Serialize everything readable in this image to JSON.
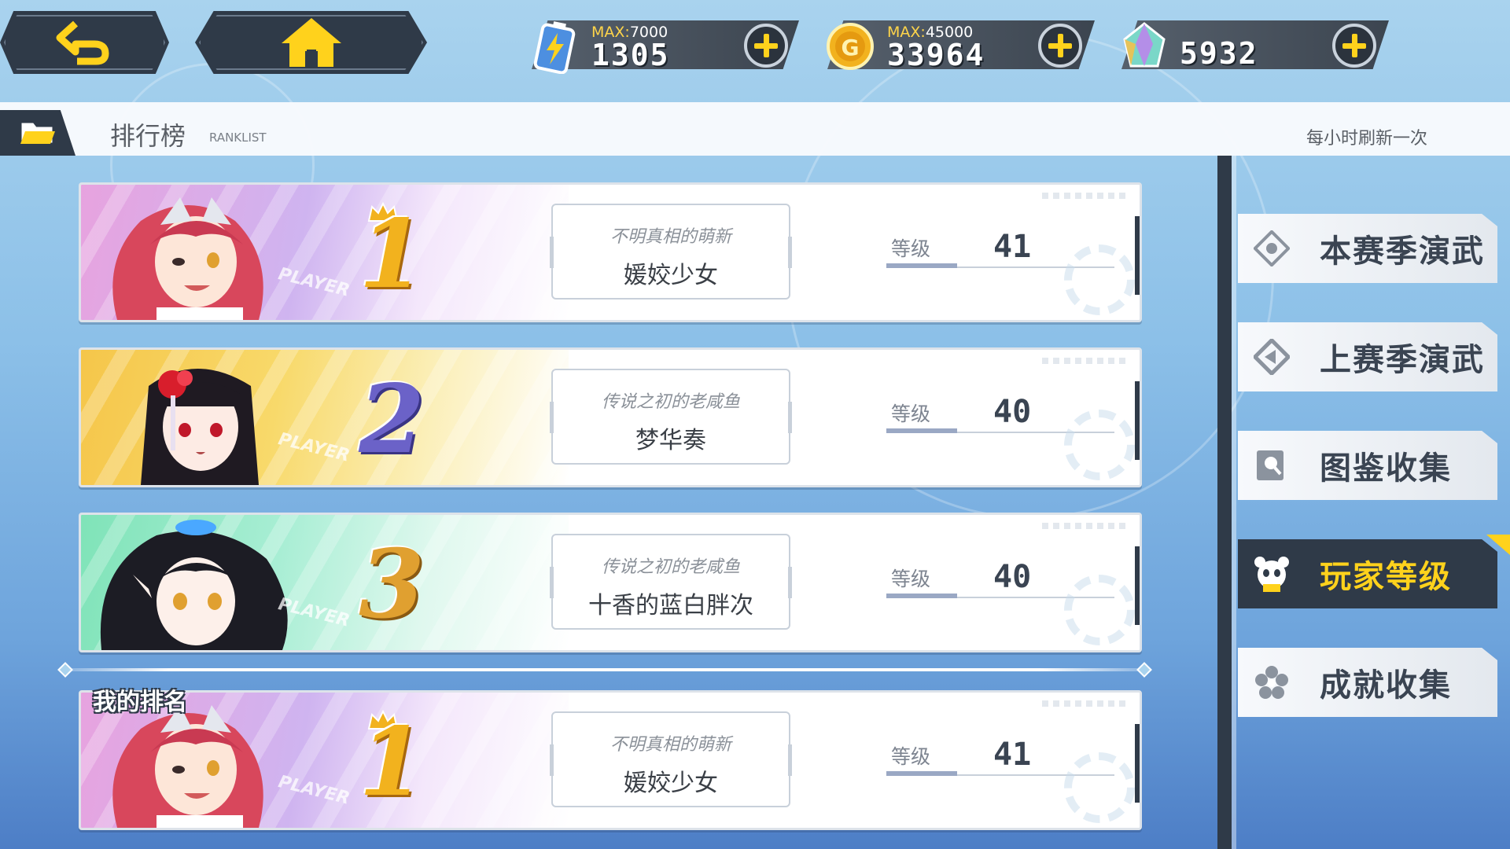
{
  "nav": {
    "back_icon": "back-arrow-icon",
    "home_icon": "home-icon"
  },
  "resources": [
    {
      "id": "energy",
      "icon": "battery-energy-icon",
      "max_label": "MAX:",
      "max_value": "7000",
      "value": "1305"
    },
    {
      "id": "coin",
      "icon": "gold-coin-icon",
      "max_label": "MAX:",
      "max_value": "45000",
      "value": "33964"
    },
    {
      "id": "crystal",
      "icon": "crystal-gem-icon",
      "max_label": "",
      "max_value": "",
      "value": "5932"
    }
  ],
  "header": {
    "title": "排行榜",
    "subtitle": "RANKLIST",
    "refresh_note": "每小时刷新一次"
  },
  "tabs": [
    {
      "label": "本赛季演武",
      "icon": "diamond-target-icon",
      "active": false
    },
    {
      "label": "上赛季演武",
      "icon": "diamond-arrow-icon",
      "active": false
    },
    {
      "label": "图鉴收集",
      "icon": "book-search-icon",
      "active": false
    },
    {
      "label": "玩家等级",
      "icon": "panda-icon",
      "active": true
    },
    {
      "label": "成就收集",
      "icon": "flower-icon",
      "active": false
    }
  ],
  "ranking": [
    {
      "rank": "1",
      "title": "不明真相的萌新",
      "name": "媛姣少女",
      "level_label": "等级",
      "level": "41",
      "tag": "PLAYER"
    },
    {
      "rank": "2",
      "title": "传说之初的老咸鱼",
      "name": "梦华奏",
      "level_label": "等级",
      "level": "40",
      "tag": "PLAYER"
    },
    {
      "rank": "3",
      "title": "传说之初的老咸鱼",
      "name": "十香的蓝白胖次",
      "level_label": "等级",
      "level": "40",
      "tag": "PLAYER"
    }
  ],
  "my_rank": {
    "label": "我的排名",
    "rank": "1",
    "title": "不明真相的萌新",
    "name": "媛姣少女",
    "level_label": "等级",
    "level": "41",
    "tag": "PLAYER"
  },
  "colors": {
    "panel_dark": "#2f3a48",
    "accent_yellow": "#ffd21c",
    "rank1_gold": "#f2b21e",
    "rank2_purple": "#6b62c8",
    "rank3_gold": "#e0a030"
  }
}
